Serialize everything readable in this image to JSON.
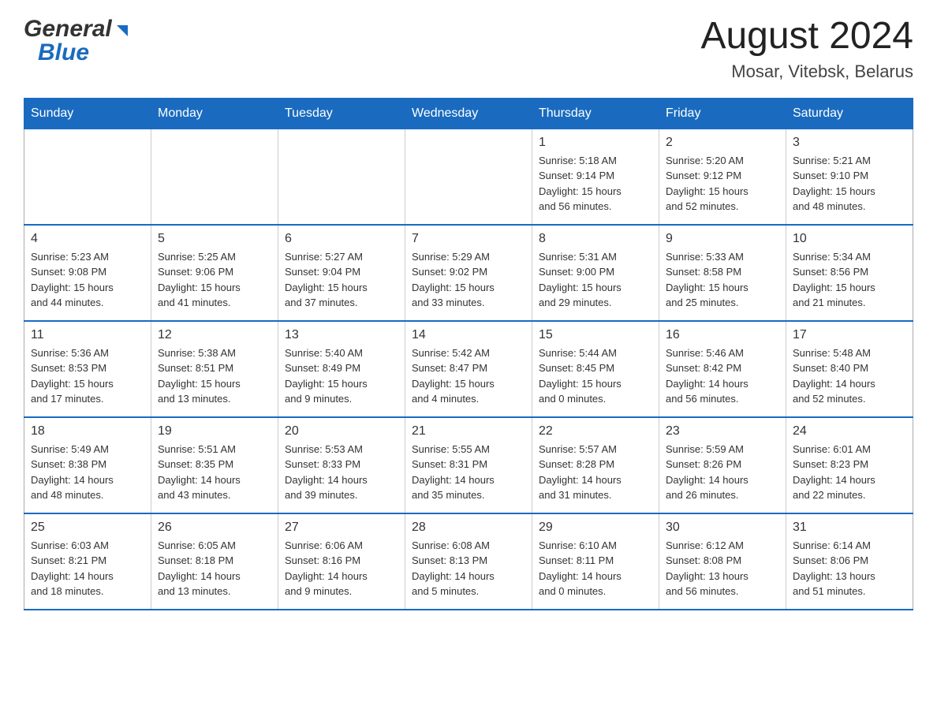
{
  "header": {
    "logo_general": "General",
    "logo_blue": "Blue",
    "month_title": "August 2024",
    "location": "Mosar, Vitebsk, Belarus"
  },
  "calendar": {
    "days_of_week": [
      "Sunday",
      "Monday",
      "Tuesday",
      "Wednesday",
      "Thursday",
      "Friday",
      "Saturday"
    ],
    "weeks": [
      {
        "cells": [
          {
            "day": "",
            "info": ""
          },
          {
            "day": "",
            "info": ""
          },
          {
            "day": "",
            "info": ""
          },
          {
            "day": "",
            "info": ""
          },
          {
            "day": "1",
            "info": "Sunrise: 5:18 AM\nSunset: 9:14 PM\nDaylight: 15 hours\nand 56 minutes."
          },
          {
            "day": "2",
            "info": "Sunrise: 5:20 AM\nSunset: 9:12 PM\nDaylight: 15 hours\nand 52 minutes."
          },
          {
            "day": "3",
            "info": "Sunrise: 5:21 AM\nSunset: 9:10 PM\nDaylight: 15 hours\nand 48 minutes."
          }
        ]
      },
      {
        "cells": [
          {
            "day": "4",
            "info": "Sunrise: 5:23 AM\nSunset: 9:08 PM\nDaylight: 15 hours\nand 44 minutes."
          },
          {
            "day": "5",
            "info": "Sunrise: 5:25 AM\nSunset: 9:06 PM\nDaylight: 15 hours\nand 41 minutes."
          },
          {
            "day": "6",
            "info": "Sunrise: 5:27 AM\nSunset: 9:04 PM\nDaylight: 15 hours\nand 37 minutes."
          },
          {
            "day": "7",
            "info": "Sunrise: 5:29 AM\nSunset: 9:02 PM\nDaylight: 15 hours\nand 33 minutes."
          },
          {
            "day": "8",
            "info": "Sunrise: 5:31 AM\nSunset: 9:00 PM\nDaylight: 15 hours\nand 29 minutes."
          },
          {
            "day": "9",
            "info": "Sunrise: 5:33 AM\nSunset: 8:58 PM\nDaylight: 15 hours\nand 25 minutes."
          },
          {
            "day": "10",
            "info": "Sunrise: 5:34 AM\nSunset: 8:56 PM\nDaylight: 15 hours\nand 21 minutes."
          }
        ]
      },
      {
        "cells": [
          {
            "day": "11",
            "info": "Sunrise: 5:36 AM\nSunset: 8:53 PM\nDaylight: 15 hours\nand 17 minutes."
          },
          {
            "day": "12",
            "info": "Sunrise: 5:38 AM\nSunset: 8:51 PM\nDaylight: 15 hours\nand 13 minutes."
          },
          {
            "day": "13",
            "info": "Sunrise: 5:40 AM\nSunset: 8:49 PM\nDaylight: 15 hours\nand 9 minutes."
          },
          {
            "day": "14",
            "info": "Sunrise: 5:42 AM\nSunset: 8:47 PM\nDaylight: 15 hours\nand 4 minutes."
          },
          {
            "day": "15",
            "info": "Sunrise: 5:44 AM\nSunset: 8:45 PM\nDaylight: 15 hours\nand 0 minutes."
          },
          {
            "day": "16",
            "info": "Sunrise: 5:46 AM\nSunset: 8:42 PM\nDaylight: 14 hours\nand 56 minutes."
          },
          {
            "day": "17",
            "info": "Sunrise: 5:48 AM\nSunset: 8:40 PM\nDaylight: 14 hours\nand 52 minutes."
          }
        ]
      },
      {
        "cells": [
          {
            "day": "18",
            "info": "Sunrise: 5:49 AM\nSunset: 8:38 PM\nDaylight: 14 hours\nand 48 minutes."
          },
          {
            "day": "19",
            "info": "Sunrise: 5:51 AM\nSunset: 8:35 PM\nDaylight: 14 hours\nand 43 minutes."
          },
          {
            "day": "20",
            "info": "Sunrise: 5:53 AM\nSunset: 8:33 PM\nDaylight: 14 hours\nand 39 minutes."
          },
          {
            "day": "21",
            "info": "Sunrise: 5:55 AM\nSunset: 8:31 PM\nDaylight: 14 hours\nand 35 minutes."
          },
          {
            "day": "22",
            "info": "Sunrise: 5:57 AM\nSunset: 8:28 PM\nDaylight: 14 hours\nand 31 minutes."
          },
          {
            "day": "23",
            "info": "Sunrise: 5:59 AM\nSunset: 8:26 PM\nDaylight: 14 hours\nand 26 minutes."
          },
          {
            "day": "24",
            "info": "Sunrise: 6:01 AM\nSunset: 8:23 PM\nDaylight: 14 hours\nand 22 minutes."
          }
        ]
      },
      {
        "cells": [
          {
            "day": "25",
            "info": "Sunrise: 6:03 AM\nSunset: 8:21 PM\nDaylight: 14 hours\nand 18 minutes."
          },
          {
            "day": "26",
            "info": "Sunrise: 6:05 AM\nSunset: 8:18 PM\nDaylight: 14 hours\nand 13 minutes."
          },
          {
            "day": "27",
            "info": "Sunrise: 6:06 AM\nSunset: 8:16 PM\nDaylight: 14 hours\nand 9 minutes."
          },
          {
            "day": "28",
            "info": "Sunrise: 6:08 AM\nSunset: 8:13 PM\nDaylight: 14 hours\nand 5 minutes."
          },
          {
            "day": "29",
            "info": "Sunrise: 6:10 AM\nSunset: 8:11 PM\nDaylight: 14 hours\nand 0 minutes."
          },
          {
            "day": "30",
            "info": "Sunrise: 6:12 AM\nSunset: 8:08 PM\nDaylight: 13 hours\nand 56 minutes."
          },
          {
            "day": "31",
            "info": "Sunrise: 6:14 AM\nSunset: 8:06 PM\nDaylight: 13 hours\nand 51 minutes."
          }
        ]
      }
    ]
  }
}
